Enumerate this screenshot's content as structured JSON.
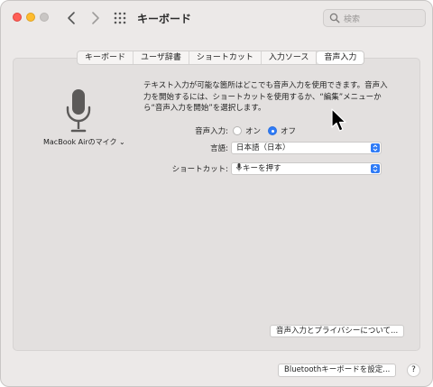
{
  "window": {
    "title": "キーボード"
  },
  "search": {
    "placeholder": "検索"
  },
  "tabs": [
    {
      "label": "キーボード",
      "active": false
    },
    {
      "label": "ユーザ辞書",
      "active": false
    },
    {
      "label": "ショートカット",
      "active": false
    },
    {
      "label": "入力ソース",
      "active": false
    },
    {
      "label": "音声入力",
      "active": true
    }
  ],
  "mic": {
    "label": "MacBook Airのマイク ⌄",
    "icon": "microphone-icon"
  },
  "description": "テキスト入力が可能な箇所はどこでも音声入力を使用できます。音声入力を開始するには、ショートカットを使用するか、“編集”メニューから“音声入力を開始”を選択します。",
  "dictation": {
    "label": "音声入力:",
    "on_label": "オン",
    "off_label": "オフ",
    "selected": "off"
  },
  "language": {
    "label": "言語:",
    "value": "日本語（日本）"
  },
  "shortcut": {
    "label": "ショートカット:",
    "value": "キーを押す"
  },
  "buttons": {
    "privacy": "音声入力とプライバシーについて...",
    "bluetooth": "Bluetoothキーボードを設定...",
    "help": "?"
  },
  "colors": {
    "accent": "#2f7bf6",
    "close": "#ff5f57",
    "minimize": "#febc2e"
  }
}
